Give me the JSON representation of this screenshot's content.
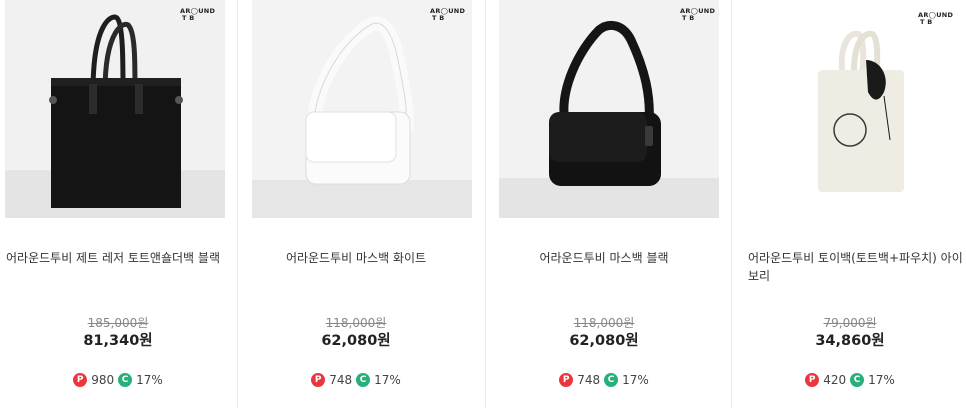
{
  "brand_logo": {
    "line1": "AR◯UND",
    "line2": "T  B"
  },
  "colors": {
    "point_badge": "#e8383d",
    "coupon_badge": "#27b07a"
  },
  "badge_icons": {
    "point": "P",
    "coupon": "C"
  },
  "products": [
    {
      "name": "어라운드투비 제트 레저 토트앤숄더백 블랙",
      "original_price": "185,000원",
      "sale_price": "81,340원",
      "points": "980",
      "discount": "17%"
    },
    {
      "name": "어라운드투비 마스백 화이트",
      "original_price": "118,000원",
      "sale_price": "62,080원",
      "points": "748",
      "discount": "17%"
    },
    {
      "name": "어라운드투비 마스백 블랙",
      "original_price": "118,000원",
      "sale_price": "62,080원",
      "points": "748",
      "discount": "17%"
    },
    {
      "name": "어라운드투비 토이백(토트백+파우치) 아이보리",
      "original_price": "79,000원",
      "sale_price": "34,860원",
      "points": "420",
      "discount": "17%"
    }
  ]
}
